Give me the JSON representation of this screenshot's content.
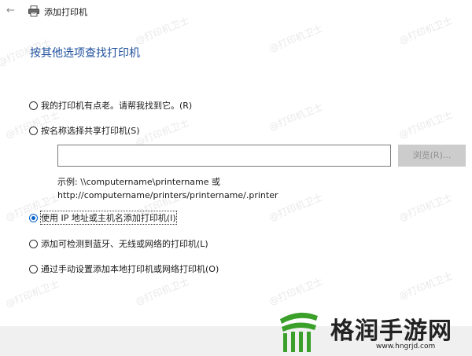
{
  "window": {
    "title": "添加打印机"
  },
  "heading": "按其他选项查找打印机",
  "options": [
    {
      "label": "我的打印机有点老。请帮我找到它。(R)",
      "selected": false
    },
    {
      "label": "按名称选择共享打印机(S)",
      "selected": false
    },
    {
      "label": "使用 IP 地址或主机名添加打印机(I)",
      "selected": true
    },
    {
      "label": "添加可检测到蓝牙、无线或网络的打印机(L)",
      "selected": false
    },
    {
      "label": "通过手动设置添加本地打印机或网络打印机(O)",
      "selected": false
    }
  ],
  "share_input": {
    "value": ""
  },
  "browse_button": {
    "label": "浏览(R)..."
  },
  "example": {
    "line1": "示例: \\\\computername\\printername 或",
    "line2": "http://computername/printers/printername/.printer"
  },
  "watermark_text": "@打印机卫士",
  "logo": {
    "name": "格润手游网",
    "url": "www.hngrjd.com"
  },
  "colors": {
    "accent": "#0b63c8",
    "heading": "#1e4f9c",
    "footer": "#f0f0f0",
    "logo_green": "#3aa02a"
  }
}
